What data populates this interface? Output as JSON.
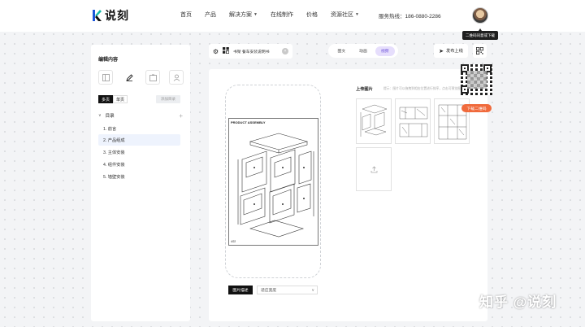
{
  "header": {
    "brand": "说刻",
    "nav": [
      {
        "label": "首页",
        "dropdown": false
      },
      {
        "label": "产品",
        "dropdown": false
      },
      {
        "label": "解决方案",
        "dropdown": true
      },
      {
        "label": "在线制作",
        "dropdown": false
      },
      {
        "label": "价格",
        "dropdown": false
      },
      {
        "label": "资源社区",
        "dropdown": true
      }
    ],
    "hotline": "服务热线：186-0880-2286",
    "tooltip": "二维码同意或下载"
  },
  "left_panel": {
    "title": "编辑内容",
    "icons": [
      "layout-icon",
      "pen-icon",
      "image-icon",
      "user-icon"
    ],
    "segments": [
      "多页",
      "单页"
    ],
    "add_dir_label": "添加目录",
    "dir_title": "目录",
    "items": [
      "1. 前言",
      "2. 产品组成",
      "3. 主体安装",
      "4. 组件安装",
      "5. 墙壁安装"
    ],
    "selected_index": 1
  },
  "toolbar": {
    "file_name": "书架 餐车安装说明书",
    "modes": [
      "图文",
      "动画",
      "视频"
    ],
    "active_mode": 2,
    "publish_label": "发布上线",
    "qr_download_label": "下载二维码"
  },
  "editor": {
    "page_title": "PRODUCT ASSEMBLY",
    "page_number": "4/22",
    "img_desc_label": "图片描述",
    "fit_label": "适应宽度"
  },
  "upload": {
    "title": "上传图片",
    "hint": "提示：图片可以拖拽到相应位置进行排序，点击可预览图片"
  },
  "watermark": "知乎 @说刻"
}
